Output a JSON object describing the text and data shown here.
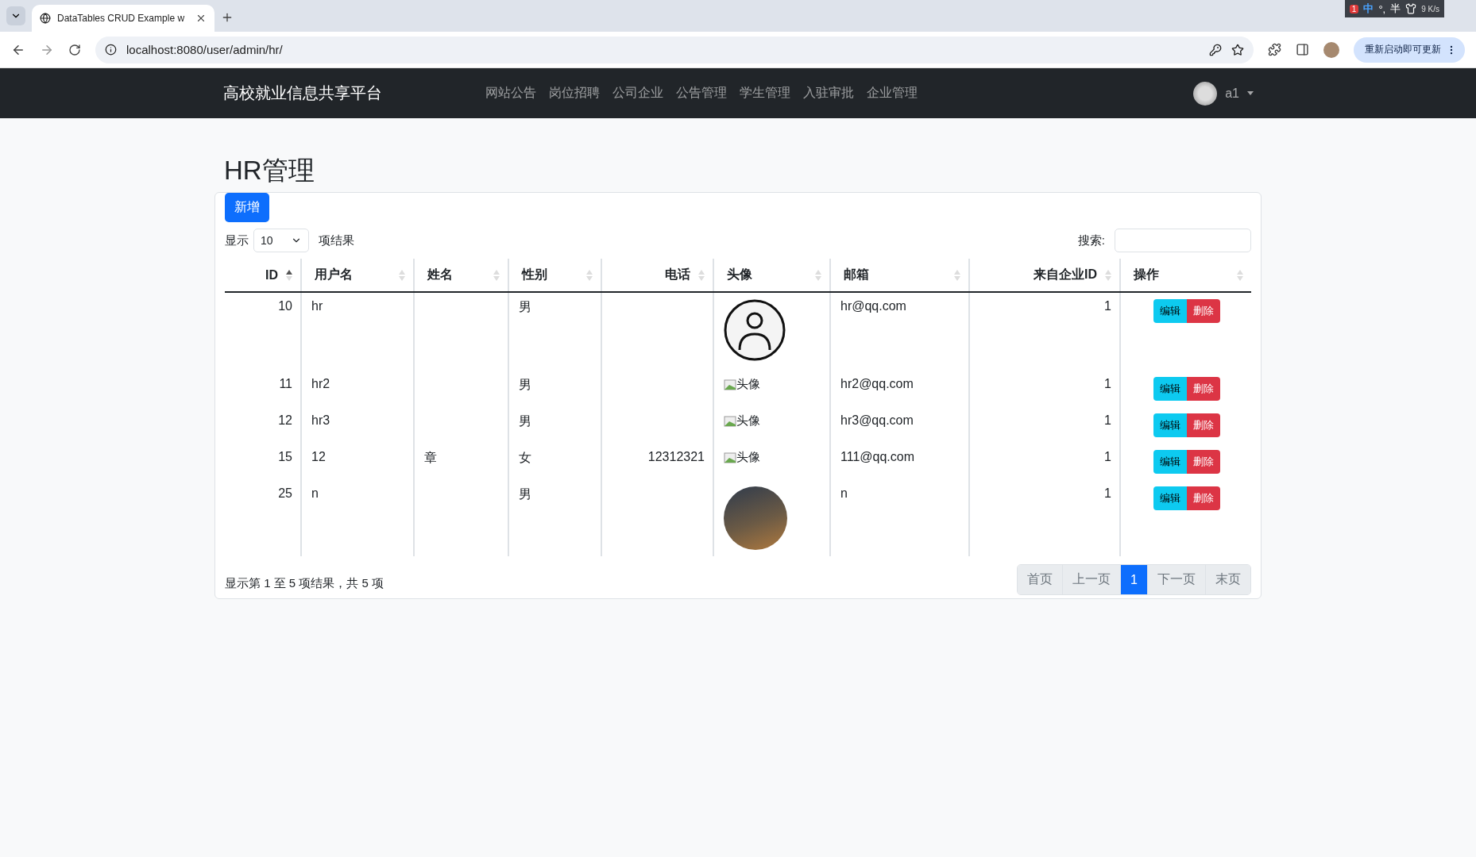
{
  "browser": {
    "tab_title": "DataTables CRUD Example w",
    "address": "localhost:8080/user/admin/hr/",
    "update_button": "重新启动即可更新",
    "ime": [
      "中",
      "°,",
      "半"
    ],
    "net_speed": "9 K/s",
    "badge": "1"
  },
  "navbar": {
    "brand": "高校就业信息共享平台",
    "links": [
      {
        "label": "网站公告",
        "selected": false
      },
      {
        "label": "岗位招聘",
        "selected": false
      },
      {
        "label": "公司企业",
        "selected": false
      },
      {
        "label": "公告管理",
        "selected": false
      },
      {
        "label": "学生管理",
        "selected": false
      },
      {
        "label": "入驻审批",
        "selected": false
      },
      {
        "label": "企业管理",
        "selected": false
      }
    ],
    "user": "a1"
  },
  "page_title": "HR管理",
  "add_button": "新增",
  "length": {
    "before": "显示",
    "value": "10",
    "after": "项结果"
  },
  "search": {
    "label": "搜索:"
  },
  "table": {
    "columns": [
      {
        "label": "ID",
        "right_aligned": true,
        "sorted": true
      },
      {
        "label": "用户名",
        "right_aligned": false,
        "sorted": false
      },
      {
        "label": "姓名",
        "right_aligned": false,
        "sorted": false
      },
      {
        "label": "性别",
        "right_aligned": false,
        "sorted": false
      },
      {
        "label": "电话",
        "right_aligned": true,
        "sorted": false
      },
      {
        "label": "头像",
        "right_aligned": false,
        "sorted": false
      },
      {
        "label": "邮箱",
        "right_aligned": false,
        "sorted": false
      },
      {
        "label": "来自企业ID",
        "right_aligned": true,
        "sorted": false
      },
      {
        "label": "操作",
        "right_aligned": false,
        "sorted": false
      }
    ],
    "rows": [
      {
        "id": "10",
        "username": "hr",
        "name": "",
        "gender": "男",
        "phone": "",
        "avatar": {
          "kind": "default"
        },
        "email": "hr@qq.com",
        "company_id": "1",
        "edit": "编辑",
        "delete": "删除"
      },
      {
        "id": "11",
        "username": "hr2",
        "name": "",
        "gender": "男",
        "phone": "",
        "avatar": {
          "kind": "broken",
          "alt": "头像"
        },
        "email": "hr2@qq.com",
        "company_id": "1",
        "edit": "编辑",
        "delete": "删除"
      },
      {
        "id": "12",
        "username": "hr3",
        "name": "",
        "gender": "男",
        "phone": "",
        "avatar": {
          "kind": "broken",
          "alt": "头像"
        },
        "email": "hr3@qq.com",
        "company_id": "1",
        "edit": "编辑",
        "delete": "删除"
      },
      {
        "id": "15",
        "username": "12",
        "name": "章",
        "gender": "女",
        "phone": "12312321",
        "avatar": {
          "kind": "broken",
          "alt": "头像"
        },
        "email": "111@qq.com",
        "company_id": "1",
        "edit": "编辑",
        "delete": "删除"
      },
      {
        "id": "25",
        "username": "n",
        "name": "",
        "gender": "男",
        "phone": "",
        "avatar": {
          "kind": "photo"
        },
        "email": "n",
        "company_id": "1",
        "edit": "编辑",
        "delete": "删除"
      }
    ]
  },
  "info": "显示第 1 至 5 项结果，共 5 项",
  "pagination": [
    {
      "label": "首页",
      "selected": false,
      "disabled": true
    },
    {
      "label": "上一页",
      "selected": false,
      "disabled": true
    },
    {
      "label": "1",
      "selected": true,
      "disabled": false
    },
    {
      "label": "下一页",
      "selected": false,
      "disabled": true
    },
    {
      "label": "末页",
      "selected": false,
      "disabled": true
    }
  ]
}
